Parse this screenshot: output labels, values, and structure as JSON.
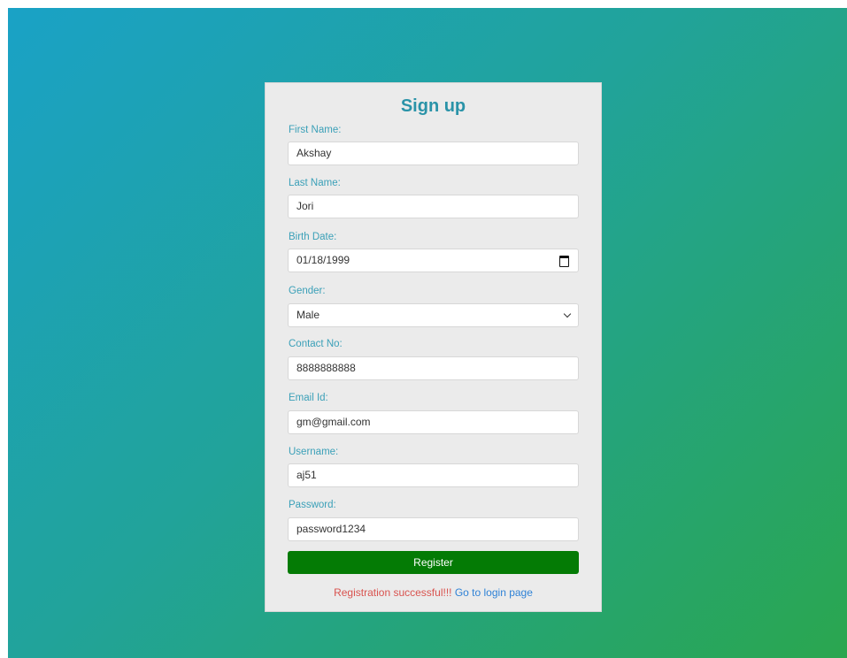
{
  "form": {
    "title": "Sign up",
    "fields": [
      {
        "label": "First Name:",
        "value": "Akshay"
      },
      {
        "label": "Last Name:",
        "value": "Jori"
      },
      {
        "label": "Birth Date:",
        "value": "01/18/1999",
        "icon": "calendar-icon"
      },
      {
        "label": "Gender:",
        "value": "Male",
        "icon": "chevron-down-icon"
      },
      {
        "label": "Contact No:",
        "value": "8888888888"
      },
      {
        "label": "Email Id:",
        "value": "gm@gmail.com"
      },
      {
        "label": "Username:",
        "value": "aj51"
      },
      {
        "label": "Password:",
        "value": "password1234"
      }
    ],
    "register_label": "Register",
    "status_message": "Registration successful!!!",
    "login_link": "Go to login page"
  },
  "colors": {
    "background_gradient": [
      "#1aa2c6",
      "#2aa64f"
    ],
    "card": "#ebebeb",
    "title": "#2a93a8",
    "label": "#3ba0b8",
    "button": "#047b05",
    "success_text": "#d9534f",
    "link": "#2f82d6"
  }
}
